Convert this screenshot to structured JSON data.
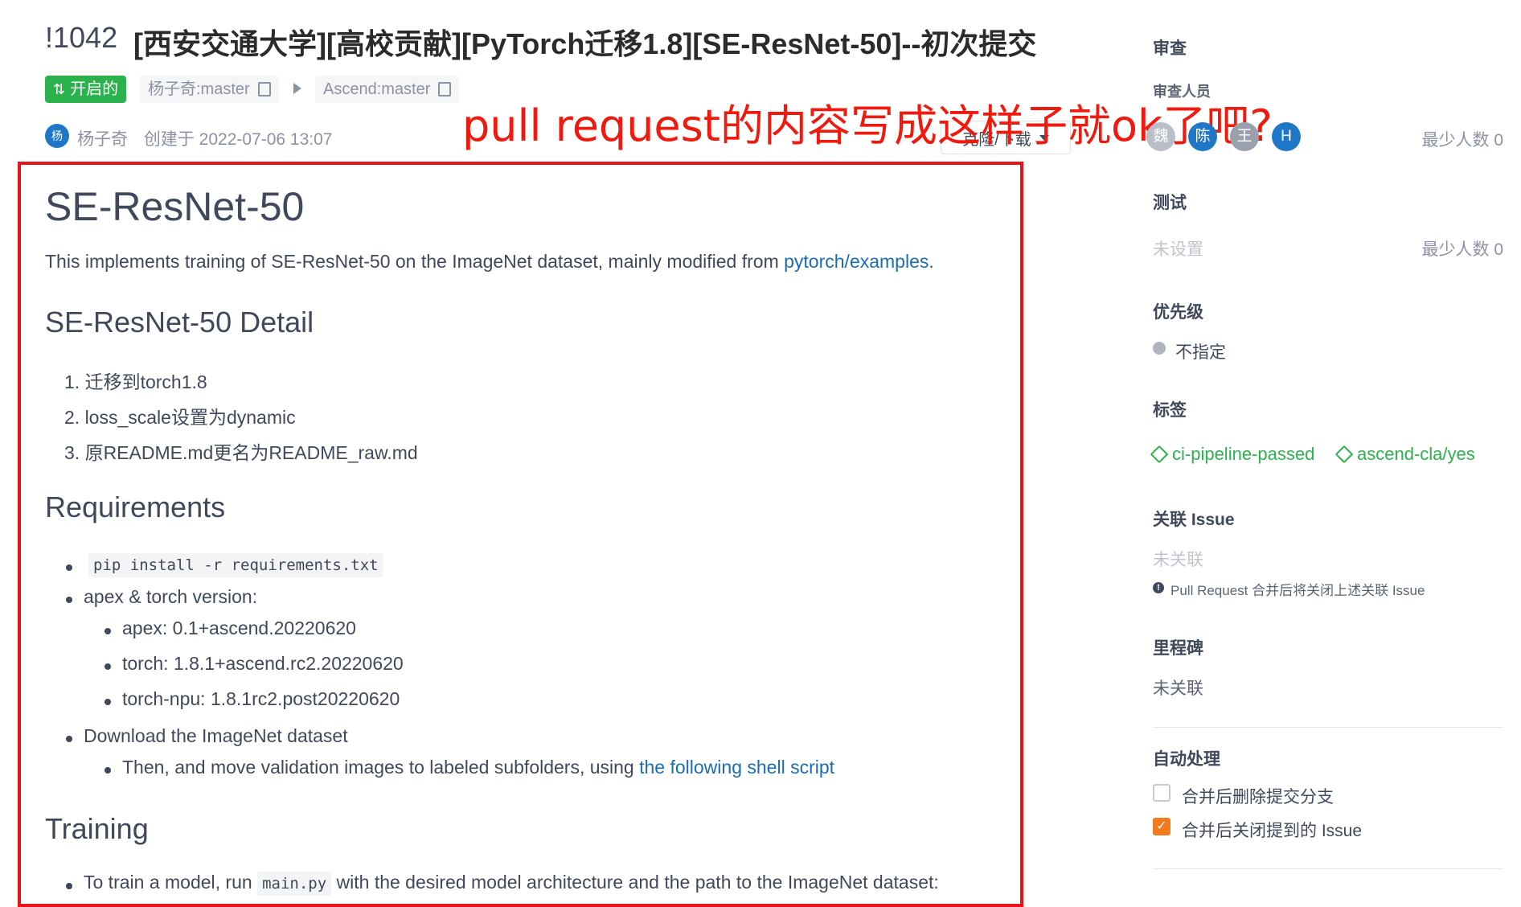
{
  "header": {
    "pr_id": "!1042",
    "title": "[西安交通大学][高校贡献][PyTorch迁移1.8][SE-ResNet-50]--初次提交",
    "status_badge": "开启的",
    "source_branch": "杨子奇:master",
    "target_branch": "Ascend:master",
    "author_avatar": "杨",
    "author_name": "杨子奇",
    "created_text": "创建于 2022-07-06 13:07",
    "clone_button": "克隆/下载"
  },
  "annotation": "pull request的内容写成这样子就ok了吧?",
  "body": {
    "h1": "SE-ResNet-50",
    "intro_text": "This implements training of SE-ResNet-50 on the ImageNet dataset, mainly modified from",
    "intro_link": "pytorch/examples",
    "intro_end": ".",
    "detail_heading": "SE-ResNet-50 Detail",
    "detail_items": [
      "1. 迁移到torch1.8",
      "2. loss_scale设置为dynamic",
      "3. 原README.md更名为README_raw.md"
    ],
    "req_heading": "Requirements",
    "req_code": "pip install -r requirements.txt",
    "req_versions": "apex & torch version:",
    "req_apex": "apex: 0.1+ascend.20220620",
    "req_torch": "torch: 1.8.1+ascend.rc2.20220620",
    "req_torch_npu": "torch-npu: 1.8.1rc2.post20220620",
    "req_download": "Download the ImageNet dataset",
    "req_then": "Then, and move validation images to labeled subfolders, using",
    "req_then_link": "the following shell script",
    "train_heading": "Training",
    "train_pre": "To train a model, run",
    "train_code": "main.py",
    "train_post": "with the desired model architecture and the path to the ImageNet dataset:"
  },
  "sidebar": {
    "review_heading": "审查",
    "reviewers_label": "审查人员",
    "reviewers": [
      "魏",
      "陈",
      "王",
      "H"
    ],
    "reviewers_min": "最少人数 0",
    "test_heading": "测试",
    "test_value": "未设置",
    "test_min": "最少人数 0",
    "priority_heading": "优先级",
    "priority_value": "不指定",
    "labels_heading": "标签",
    "labels": [
      "ci-pipeline-passed",
      "ascend-cla/yes"
    ],
    "issue_heading": "关联 Issue",
    "issue_value": "未关联",
    "issue_note": "Pull Request 合并后将关闭上述关联 Issue",
    "milestone_heading": "里程碑",
    "milestone_value": "未关联",
    "auto_heading": "自动处理",
    "auto_delete_branch": "合并后删除提交分支",
    "auto_close_issue": "合并后关闭提到的 Issue",
    "auto_delete_checked": false,
    "auto_close_checked": true
  },
  "colors": {
    "accent": "#2bb24c",
    "link": "#1a6db3",
    "annotation_red": "#f0190e",
    "checkbox_orange": "#f37b1d"
  }
}
